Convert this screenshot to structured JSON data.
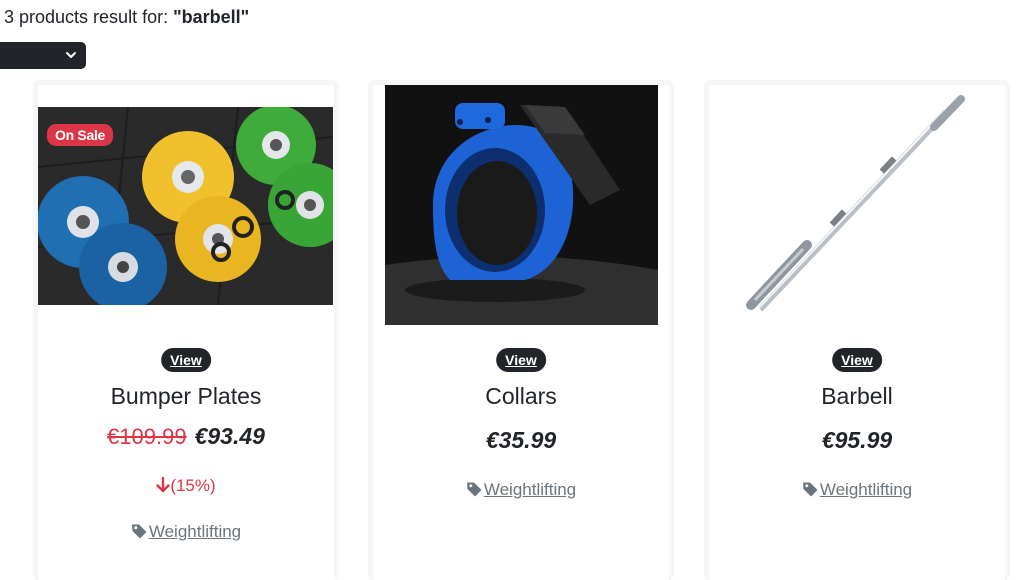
{
  "search": {
    "count_text": "3 products result for: ",
    "query_text": "\"barbell\""
  },
  "sort": {
    "selected": "",
    "icon": "chevron-down-icon"
  },
  "products": [
    {
      "name": "Bumper Plates",
      "view_label": "View",
      "badge": "On Sale",
      "old_price": "€109.99",
      "price": "€93.49",
      "discount": "(15%)",
      "category": "Weightlifting"
    },
    {
      "name": "Collars",
      "view_label": "View",
      "price": "€35.99",
      "category": "Weightlifting"
    },
    {
      "name": "Barbell",
      "view_label": "View",
      "price": "€95.99",
      "category": "Weightlifting"
    }
  ],
  "colors": {
    "sale_red": "#dc3545",
    "dark": "#212529",
    "muted": "#6c757d"
  }
}
